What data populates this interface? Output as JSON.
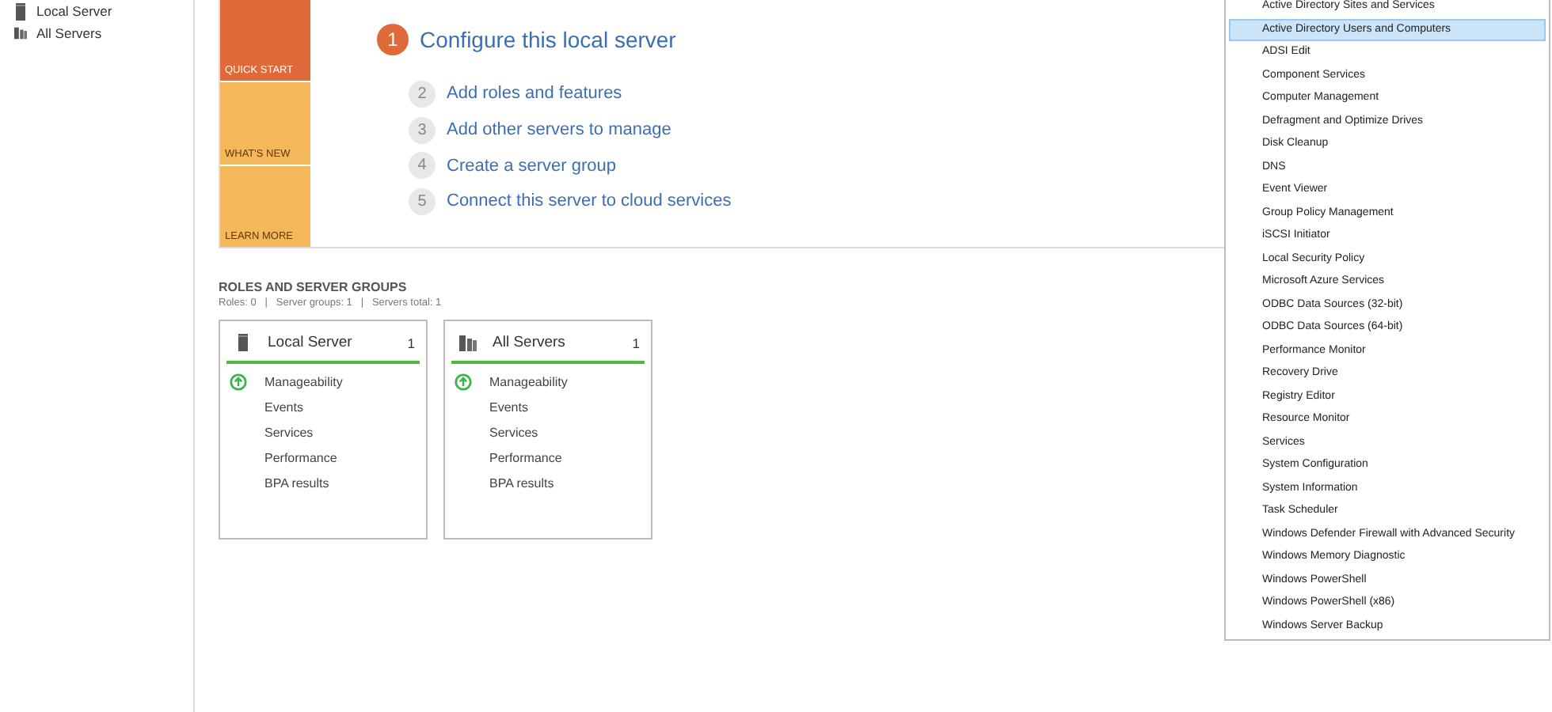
{
  "sidebar": {
    "items": [
      {
        "label": "Local Server",
        "kind": "single"
      },
      {
        "label": "All Servers",
        "kind": "multi"
      }
    ]
  },
  "quick_start": {
    "tiles": [
      {
        "label": "QUICK START",
        "selected": true
      },
      {
        "label": "WHAT'S NEW",
        "selected": false
      },
      {
        "label": "LEARN MORE",
        "selected": false
      }
    ],
    "steps": [
      {
        "number": "1",
        "label": "Configure this local server",
        "selected": true
      },
      {
        "number": "2",
        "label": "Add roles and features",
        "selected": false
      },
      {
        "number": "3",
        "label": "Add other servers to manage",
        "selected": false
      },
      {
        "number": "4",
        "label": "Create a server group",
        "selected": false
      },
      {
        "number": "5",
        "label": "Connect this server to cloud services",
        "selected": false
      }
    ]
  },
  "roles": {
    "title": "ROLES AND SERVER GROUPS",
    "summary": "Roles: 0   |   Server groups: 1   |   Servers total: 1",
    "cards": [
      {
        "title": "Local Server",
        "count": "1",
        "kind": "single",
        "rows": [
          {
            "label": "Manageability",
            "ok": true
          },
          {
            "label": "Events",
            "ok": false
          },
          {
            "label": "Services",
            "ok": false
          },
          {
            "label": "Performance",
            "ok": false
          },
          {
            "label": "BPA results",
            "ok": false
          }
        ]
      },
      {
        "title": "All Servers",
        "count": "1",
        "kind": "multi",
        "rows": [
          {
            "label": "Manageability",
            "ok": true
          },
          {
            "label": "Events",
            "ok": false
          },
          {
            "label": "Services",
            "ok": false
          },
          {
            "label": "Performance",
            "ok": false
          },
          {
            "label": "BPA results",
            "ok": false
          }
        ]
      }
    ]
  },
  "tools_menu": {
    "items": [
      {
        "label": "Active Directory Sites and Services",
        "selected": false
      },
      {
        "label": "Active Directory Users and Computers",
        "selected": true
      },
      {
        "label": "ADSI Edit",
        "selected": false
      },
      {
        "label": "Component Services",
        "selected": false
      },
      {
        "label": "Computer Management",
        "selected": false
      },
      {
        "label": "Defragment and Optimize Drives",
        "selected": false
      },
      {
        "label": "Disk Cleanup",
        "selected": false
      },
      {
        "label": "DNS",
        "selected": false
      },
      {
        "label": "Event Viewer",
        "selected": false
      },
      {
        "label": "Group Policy Management",
        "selected": false
      },
      {
        "label": "iSCSI Initiator",
        "selected": false
      },
      {
        "label": "Local Security Policy",
        "selected": false
      },
      {
        "label": "Microsoft Azure Services",
        "selected": false
      },
      {
        "label": "ODBC Data Sources (32-bit)",
        "selected": false
      },
      {
        "label": "ODBC Data Sources (64-bit)",
        "selected": false
      },
      {
        "label": "Performance Monitor",
        "selected": false
      },
      {
        "label": "Recovery Drive",
        "selected": false
      },
      {
        "label": "Registry Editor",
        "selected": false
      },
      {
        "label": "Resource Monitor",
        "selected": false
      },
      {
        "label": "Services",
        "selected": false
      },
      {
        "label": "System Configuration",
        "selected": false
      },
      {
        "label": "System Information",
        "selected": false
      },
      {
        "label": "Task Scheduler",
        "selected": false
      },
      {
        "label": "Windows Defender Firewall with Advanced Security",
        "selected": false
      },
      {
        "label": "Windows Memory Diagnostic",
        "selected": false
      },
      {
        "label": "Windows PowerShell",
        "selected": false
      },
      {
        "label": "Windows PowerShell (x86)",
        "selected": false
      },
      {
        "label": "Windows Server Backup",
        "selected": false
      }
    ]
  }
}
